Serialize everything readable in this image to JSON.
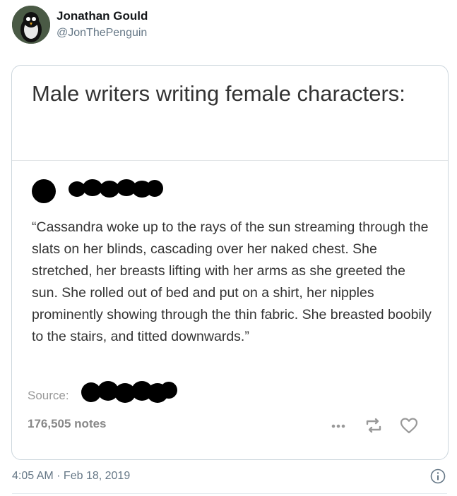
{
  "tweet": {
    "author_name": "Jonathan Gould",
    "author_handle": "@JonThePenguin",
    "timestamp": "4:05 AM · Feb 18, 2019"
  },
  "embedded_post": {
    "title": "Male writers writing female characters:",
    "quote": "“Cassandra woke up to the rays of the sun streaming through the slats on her blinds, cascading over her naked chest. She stretched, her breasts lifting with her arms as she greeted the sun. She rolled out of bed and put on a shirt, her nipples prominently showing through the thin fabric. She breasted boobily to the stairs, and titted downwards.”",
    "source_label": "Source:",
    "notes": "176,505 notes",
    "icons": [
      "more-icon",
      "reblog-icon",
      "heart-icon"
    ]
  },
  "colors": {
    "text_dark": "#14171a",
    "text_muted": "#657786",
    "card_border": "#ccd6dd",
    "post_text": "#333333",
    "notes_gray": "#888888"
  }
}
